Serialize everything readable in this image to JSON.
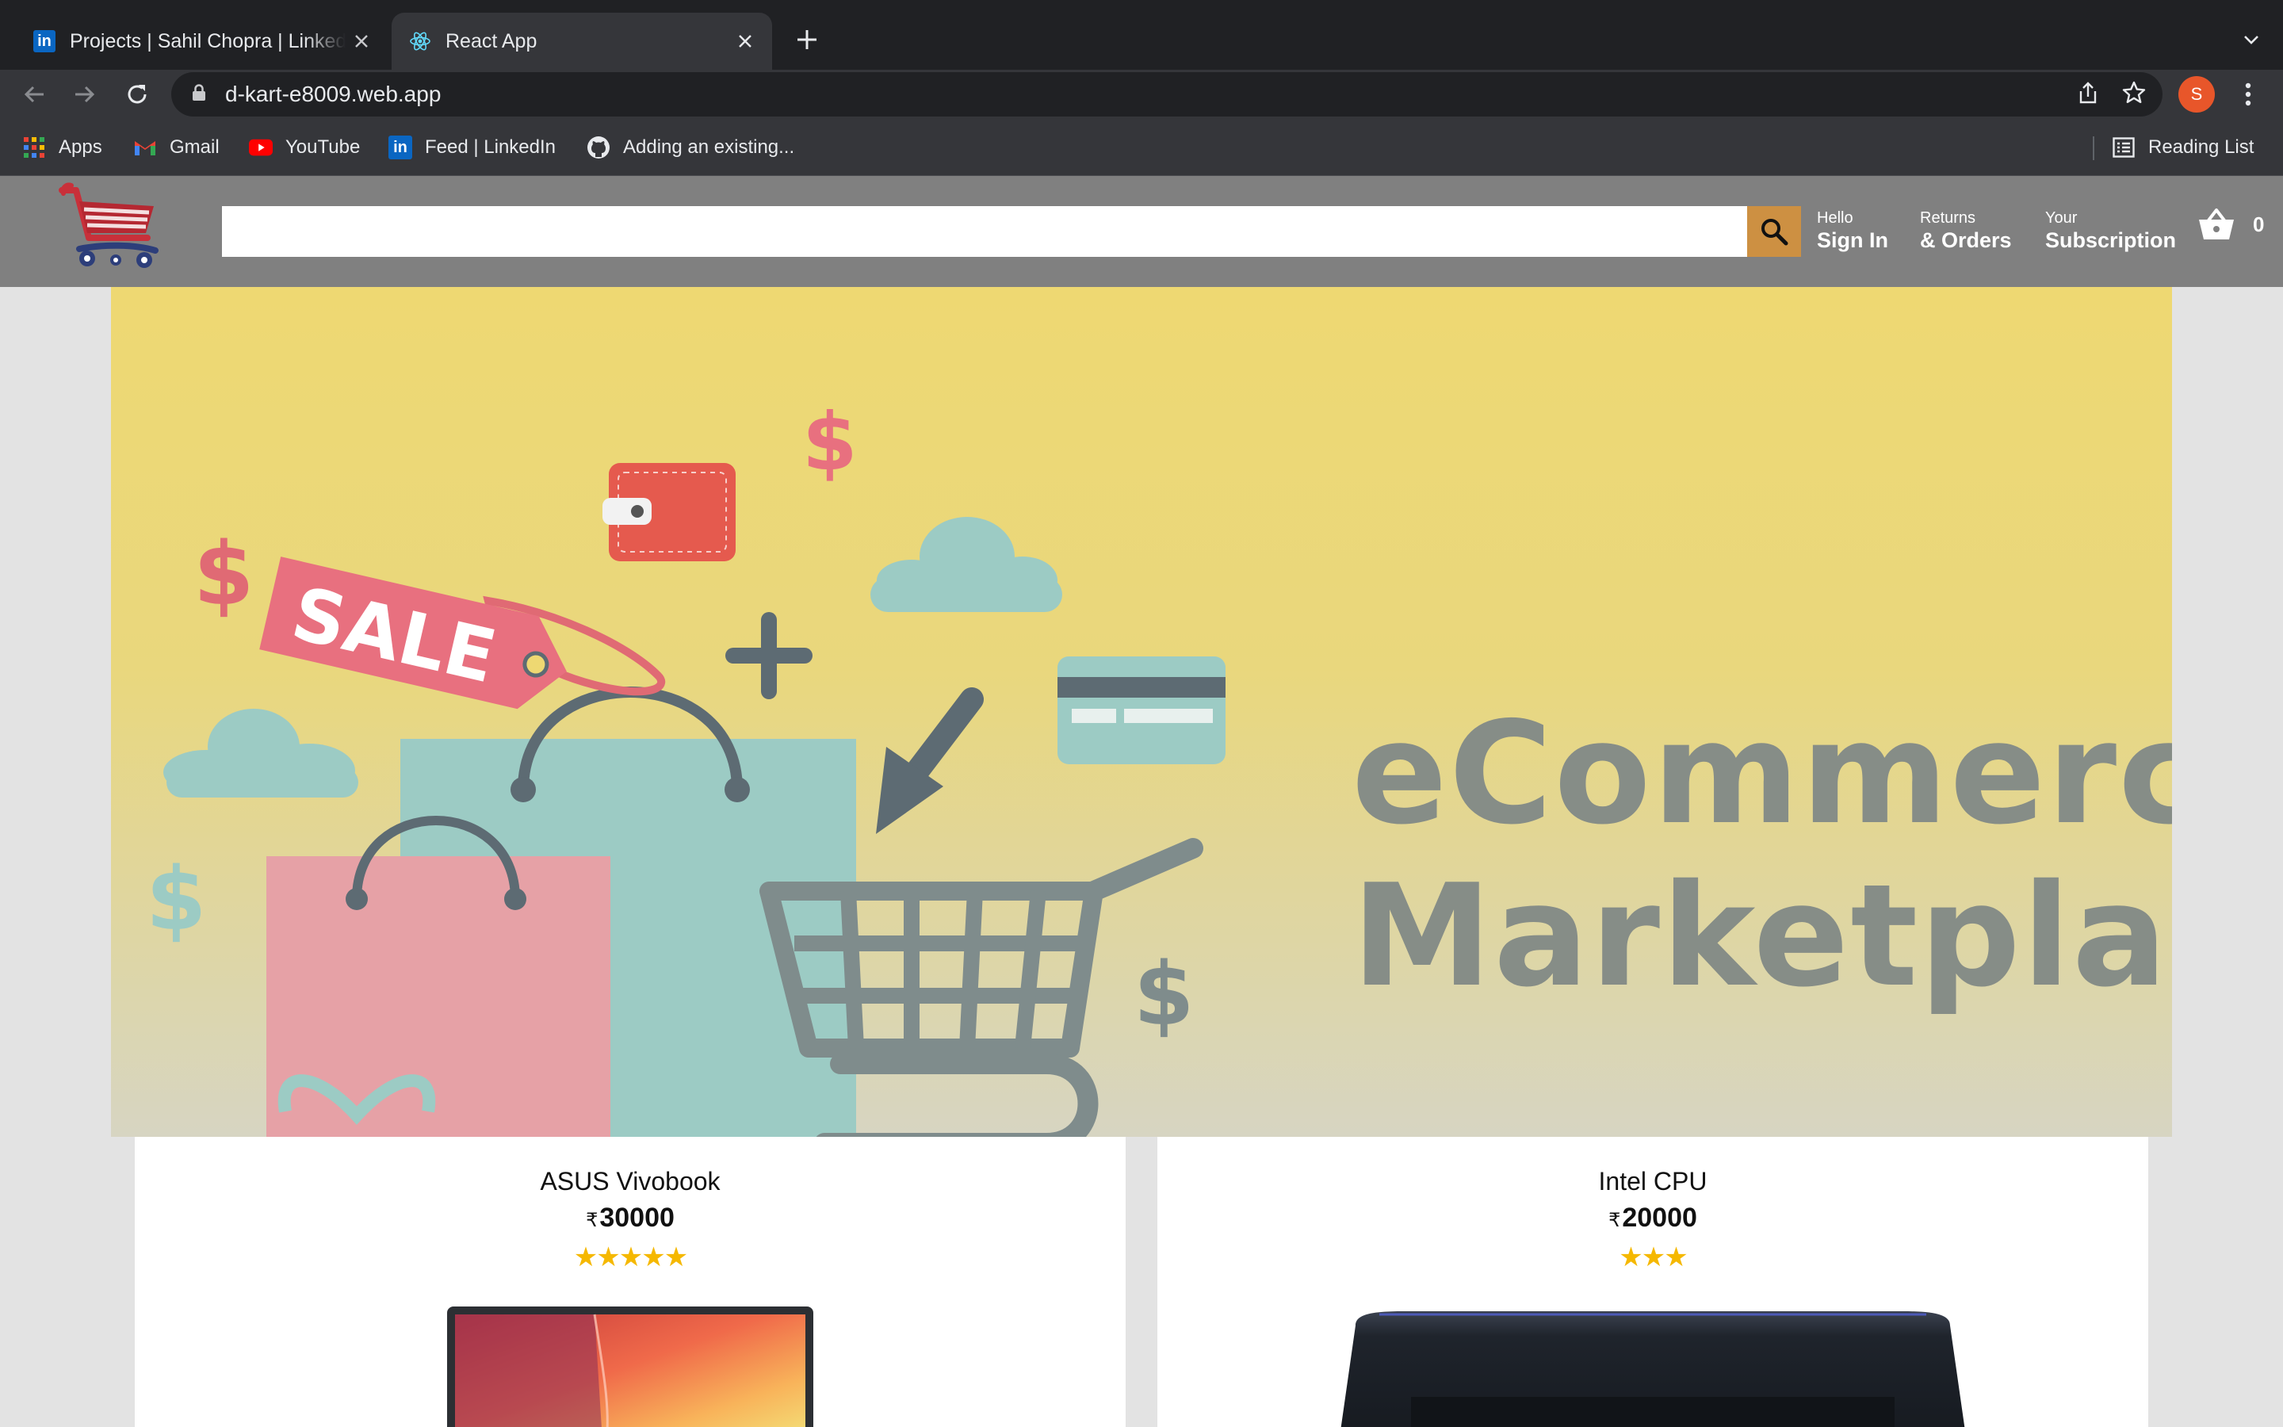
{
  "browser": {
    "tabs": [
      {
        "title": "Projects | Sahil Chopra | LinkedIn",
        "active": false,
        "favicon": "linkedin-icon"
      },
      {
        "title": "React App",
        "active": true,
        "favicon": "react-icon"
      }
    ],
    "url": "d-kart-e8009.web.app",
    "profile_initial": "S",
    "bookmarks": [
      {
        "label": "Apps",
        "icon": "apps-grid-icon"
      },
      {
        "label": "Gmail",
        "icon": "gmail-icon"
      },
      {
        "label": "YouTube",
        "icon": "youtube-icon"
      },
      {
        "label": "Feed | LinkedIn",
        "icon": "linkedin-icon"
      },
      {
        "label": "Adding an existing...",
        "icon": "github-icon"
      }
    ],
    "reading_list": "Reading List"
  },
  "header": {
    "search_placeholder": "",
    "nav": [
      {
        "line1": "Hello",
        "line2": "Sign In"
      },
      {
        "line1": "Returns",
        "line2": "& Orders"
      },
      {
        "line1": "Your",
        "line2": "Subscription"
      }
    ],
    "cart_count": "0"
  },
  "hero": {
    "line1": "eCommerce",
    "line2": "Marketplace",
    "sale_tag": "SALE",
    "colors": {
      "background": "#eed872",
      "text": "#868d87",
      "pink": "#e8707f",
      "teal": "#9ccbc4",
      "gray": "#7f8c8c"
    }
  },
  "products": [
    {
      "title": "ASUS Vivobook",
      "currency": "₹",
      "price": "30000",
      "rating": 5,
      "stars": "★★★★★"
    },
    {
      "title": "Intel CPU",
      "currency": "₹",
      "price": "20000",
      "rating": 3,
      "stars": "★★★"
    }
  ]
}
